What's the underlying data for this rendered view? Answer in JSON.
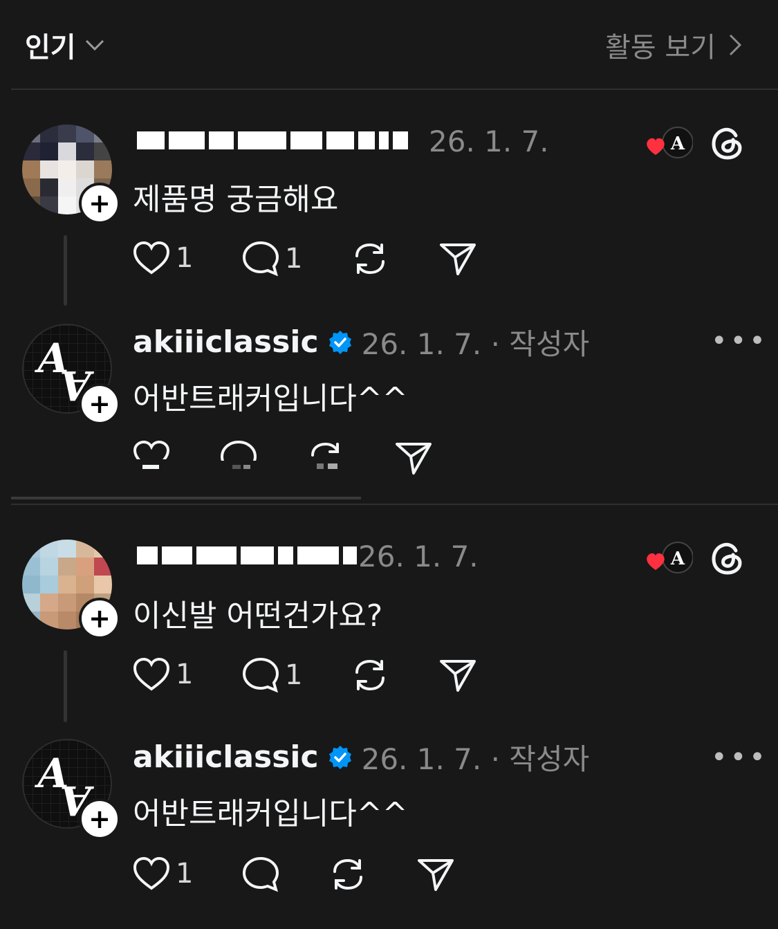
{
  "header": {
    "sort_label": "인기",
    "activity_label": "활동 보기"
  },
  "posts": [
    {
      "date": "26. 1. 7.",
      "text": "제품명 궁금해요",
      "likes": "1",
      "replies": "1",
      "reply": {
        "username": "akiiiclassic",
        "date_author": "26. 1. 7. · 작성자",
        "text": "어반트래커입니다^^"
      }
    },
    {
      "date": "26. 1. 7.",
      "text": "이신발 어떤건가요?",
      "likes": "1",
      "replies": "1",
      "reply": {
        "username": "akiiiclassic",
        "date_author": "26. 1. 7. · 작성자",
        "text": "어반트래커입니다^^",
        "likes": "1"
      }
    }
  ],
  "colors": {
    "background": "#181818",
    "heart": "#ff3040",
    "verified": "#0095f6",
    "muted": "#8a8a8a"
  }
}
